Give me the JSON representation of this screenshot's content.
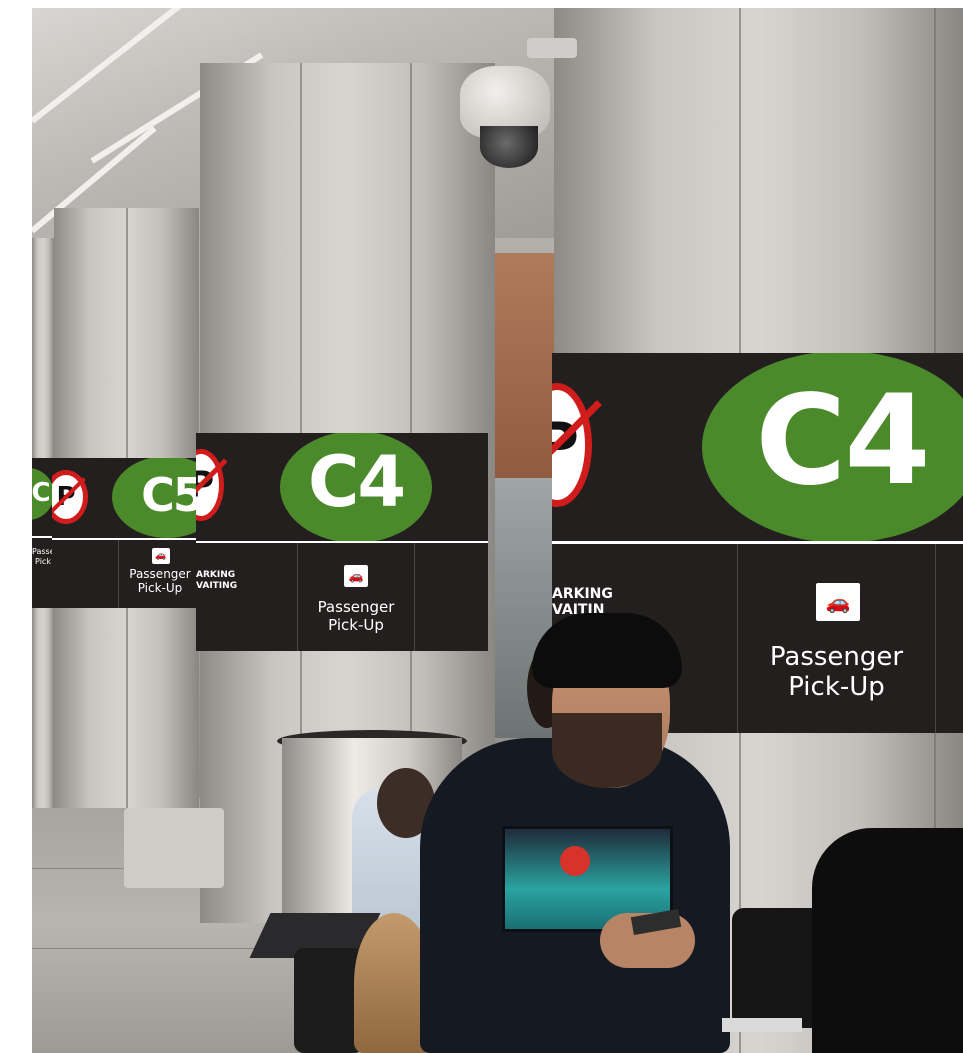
{
  "scene": {
    "colors": {
      "sign_background": "#221f1e",
      "gate_badge": "#4b8a2a",
      "no_parking_red": "#d11c1c",
      "text": "#ffffff"
    }
  },
  "signs": [
    {
      "id": "far-left",
      "gate": "C",
      "label_line1": "Passer",
      "label_line2": "Pick",
      "icon": "pickup-car-icon"
    },
    {
      "id": "far",
      "gate": "C5",
      "label_line1": "Passenger",
      "label_line2": "Pick-Up",
      "icon": "pickup-car-icon"
    },
    {
      "id": "middle",
      "gate": "C4",
      "label_line1": "Passenger",
      "label_line2": "Pick-Up",
      "fine_line1": "ARKING",
      "fine_line2": "VAITING",
      "icon": "pickup-car-icon"
    },
    {
      "id": "front",
      "gate": "C4",
      "label_line1": "Passenger",
      "label_line2": "Pick-Up",
      "fine_line1": "ARKING",
      "fine_line2": "VAITIN",
      "icon": "pickup-car-icon"
    }
  ],
  "icons": {
    "no_parking": "no-parking-icon",
    "camera": "security-camera-icon",
    "pickup": "pickup-car-icon"
  }
}
